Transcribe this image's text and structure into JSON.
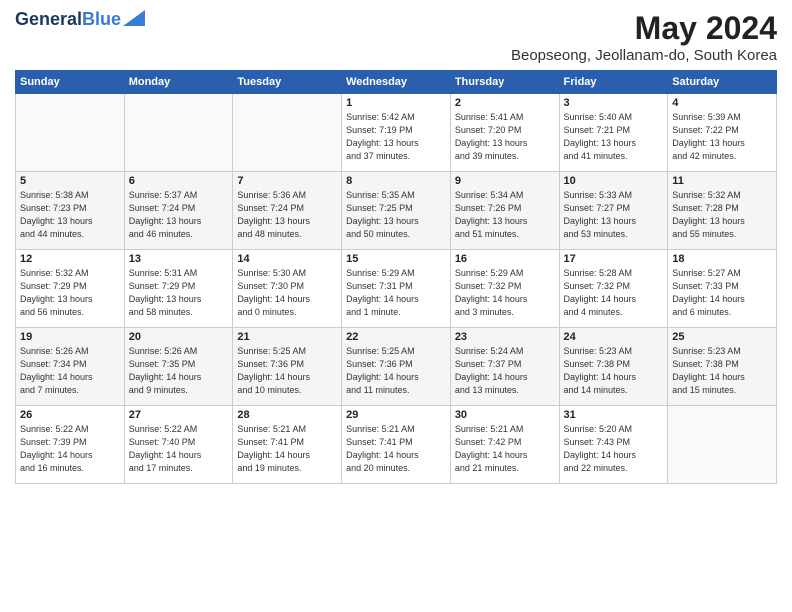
{
  "header": {
    "logo_line1": "General",
    "logo_line2": "Blue",
    "month": "May 2024",
    "location": "Beopseong, Jeollanam-do, South Korea"
  },
  "days_of_week": [
    "Sunday",
    "Monday",
    "Tuesday",
    "Wednesday",
    "Thursday",
    "Friday",
    "Saturday"
  ],
  "weeks": [
    [
      {
        "day": "",
        "info": ""
      },
      {
        "day": "",
        "info": ""
      },
      {
        "day": "",
        "info": ""
      },
      {
        "day": "1",
        "info": "Sunrise: 5:42 AM\nSunset: 7:19 PM\nDaylight: 13 hours\nand 37 minutes."
      },
      {
        "day": "2",
        "info": "Sunrise: 5:41 AM\nSunset: 7:20 PM\nDaylight: 13 hours\nand 39 minutes."
      },
      {
        "day": "3",
        "info": "Sunrise: 5:40 AM\nSunset: 7:21 PM\nDaylight: 13 hours\nand 41 minutes."
      },
      {
        "day": "4",
        "info": "Sunrise: 5:39 AM\nSunset: 7:22 PM\nDaylight: 13 hours\nand 42 minutes."
      }
    ],
    [
      {
        "day": "5",
        "info": "Sunrise: 5:38 AM\nSunset: 7:23 PM\nDaylight: 13 hours\nand 44 minutes."
      },
      {
        "day": "6",
        "info": "Sunrise: 5:37 AM\nSunset: 7:24 PM\nDaylight: 13 hours\nand 46 minutes."
      },
      {
        "day": "7",
        "info": "Sunrise: 5:36 AM\nSunset: 7:24 PM\nDaylight: 13 hours\nand 48 minutes."
      },
      {
        "day": "8",
        "info": "Sunrise: 5:35 AM\nSunset: 7:25 PM\nDaylight: 13 hours\nand 50 minutes."
      },
      {
        "day": "9",
        "info": "Sunrise: 5:34 AM\nSunset: 7:26 PM\nDaylight: 13 hours\nand 51 minutes."
      },
      {
        "day": "10",
        "info": "Sunrise: 5:33 AM\nSunset: 7:27 PM\nDaylight: 13 hours\nand 53 minutes."
      },
      {
        "day": "11",
        "info": "Sunrise: 5:32 AM\nSunset: 7:28 PM\nDaylight: 13 hours\nand 55 minutes."
      }
    ],
    [
      {
        "day": "12",
        "info": "Sunrise: 5:32 AM\nSunset: 7:29 PM\nDaylight: 13 hours\nand 56 minutes."
      },
      {
        "day": "13",
        "info": "Sunrise: 5:31 AM\nSunset: 7:29 PM\nDaylight: 13 hours\nand 58 minutes."
      },
      {
        "day": "14",
        "info": "Sunrise: 5:30 AM\nSunset: 7:30 PM\nDaylight: 14 hours\nand 0 minutes."
      },
      {
        "day": "15",
        "info": "Sunrise: 5:29 AM\nSunset: 7:31 PM\nDaylight: 14 hours\nand 1 minute."
      },
      {
        "day": "16",
        "info": "Sunrise: 5:29 AM\nSunset: 7:32 PM\nDaylight: 14 hours\nand 3 minutes."
      },
      {
        "day": "17",
        "info": "Sunrise: 5:28 AM\nSunset: 7:32 PM\nDaylight: 14 hours\nand 4 minutes."
      },
      {
        "day": "18",
        "info": "Sunrise: 5:27 AM\nSunset: 7:33 PM\nDaylight: 14 hours\nand 6 minutes."
      }
    ],
    [
      {
        "day": "19",
        "info": "Sunrise: 5:26 AM\nSunset: 7:34 PM\nDaylight: 14 hours\nand 7 minutes."
      },
      {
        "day": "20",
        "info": "Sunrise: 5:26 AM\nSunset: 7:35 PM\nDaylight: 14 hours\nand 9 minutes."
      },
      {
        "day": "21",
        "info": "Sunrise: 5:25 AM\nSunset: 7:36 PM\nDaylight: 14 hours\nand 10 minutes."
      },
      {
        "day": "22",
        "info": "Sunrise: 5:25 AM\nSunset: 7:36 PM\nDaylight: 14 hours\nand 11 minutes."
      },
      {
        "day": "23",
        "info": "Sunrise: 5:24 AM\nSunset: 7:37 PM\nDaylight: 14 hours\nand 13 minutes."
      },
      {
        "day": "24",
        "info": "Sunrise: 5:23 AM\nSunset: 7:38 PM\nDaylight: 14 hours\nand 14 minutes."
      },
      {
        "day": "25",
        "info": "Sunrise: 5:23 AM\nSunset: 7:38 PM\nDaylight: 14 hours\nand 15 minutes."
      }
    ],
    [
      {
        "day": "26",
        "info": "Sunrise: 5:22 AM\nSunset: 7:39 PM\nDaylight: 14 hours\nand 16 minutes."
      },
      {
        "day": "27",
        "info": "Sunrise: 5:22 AM\nSunset: 7:40 PM\nDaylight: 14 hours\nand 17 minutes."
      },
      {
        "day": "28",
        "info": "Sunrise: 5:21 AM\nSunset: 7:41 PM\nDaylight: 14 hours\nand 19 minutes."
      },
      {
        "day": "29",
        "info": "Sunrise: 5:21 AM\nSunset: 7:41 PM\nDaylight: 14 hours\nand 20 minutes."
      },
      {
        "day": "30",
        "info": "Sunrise: 5:21 AM\nSunset: 7:42 PM\nDaylight: 14 hours\nand 21 minutes."
      },
      {
        "day": "31",
        "info": "Sunrise: 5:20 AM\nSunset: 7:43 PM\nDaylight: 14 hours\nand 22 minutes."
      },
      {
        "day": "",
        "info": ""
      }
    ]
  ]
}
